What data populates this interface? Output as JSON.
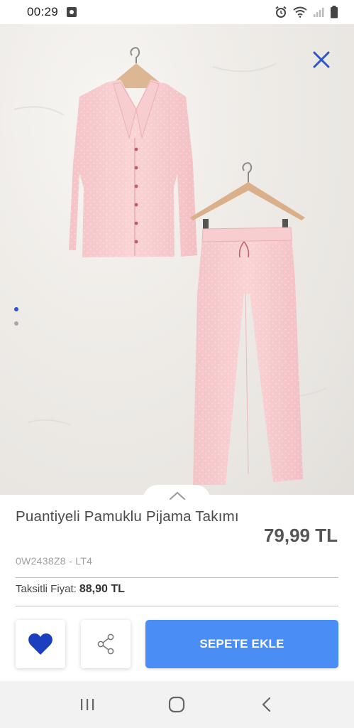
{
  "status_bar": {
    "time": "00:29",
    "icons": [
      "notification-app-icon",
      "alarm-icon",
      "wifi-icon",
      "signal-icon",
      "battery-icon"
    ]
  },
  "gallery": {
    "image": "pink-polka-dot-pajama-set-photo",
    "total_images": 2,
    "active_index": 0,
    "close_icon": "close-icon"
  },
  "product": {
    "name": "Puantiyeli Pamuklu Pijama Takımı",
    "price": "79,99 TL",
    "sku": "0W2438Z8 - LT4",
    "installment_label": "Taksitli Fiyat:",
    "installment_price": "88,90 TL"
  },
  "actions": {
    "favorite_icon": "heart-icon",
    "share_icon": "share-icon",
    "add_to_cart_label": "SEPETE EKLE"
  },
  "navbar": {
    "items": [
      "recent-apps-icon",
      "home-icon",
      "back-icon"
    ]
  },
  "colors": {
    "accent": "#4a8df5",
    "heart": "#1c3fbf",
    "close": "#2b55c8",
    "garment": "#f9cfd1"
  }
}
